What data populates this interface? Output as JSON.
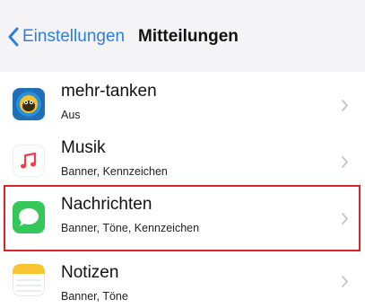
{
  "navbar": {
    "back_label": "Einstellungen",
    "title": "Mitteilungen"
  },
  "rows": [
    {
      "title": "mehr-tanken",
      "subtitle": "Aus",
      "icon": "mehr-tanken-app-icon"
    },
    {
      "title": "Musik",
      "subtitle": "Banner, Kennzeichen",
      "icon": "music-note-icon"
    },
    {
      "title": "Nachrichten",
      "subtitle": "Banner, Töne, Kennzeichen",
      "icon": "messages-bubble-icon"
    },
    {
      "title": "Notizen",
      "subtitle": "Banner, Töne",
      "icon": "notes-app-icon"
    }
  ],
  "colors": {
    "accent": "#2e7de0",
    "highlight_border": "#d8242a",
    "messages_green": "#34c759",
    "music_red": "#fc3c44",
    "notes_yellow": "#f7c531"
  }
}
